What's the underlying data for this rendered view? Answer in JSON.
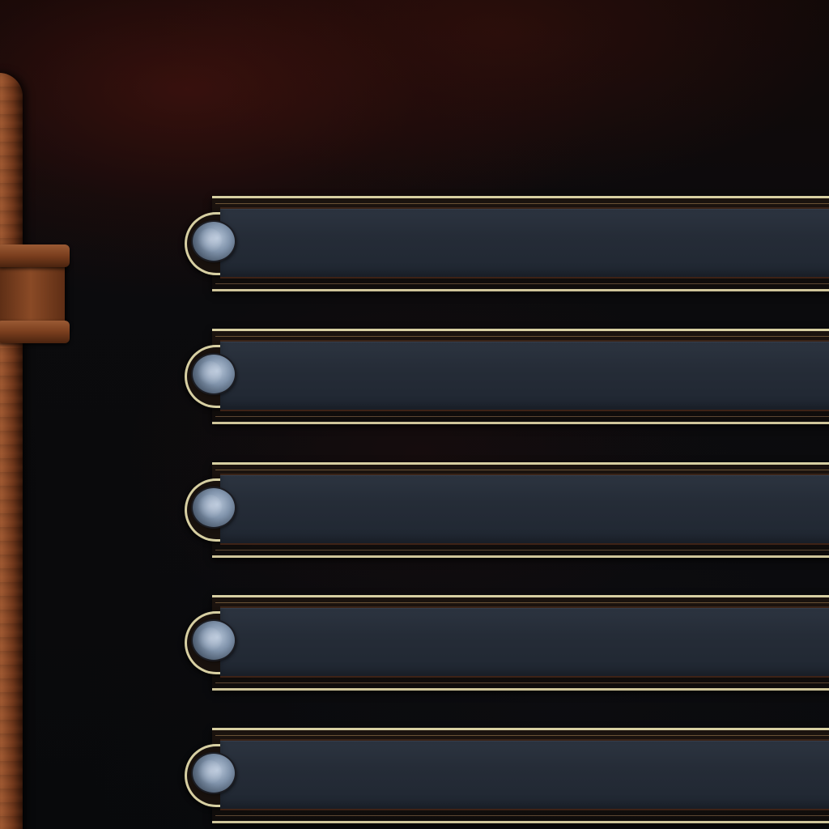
{
  "menu": {
    "slots": [
      {
        "label": ""
      },
      {
        "label": ""
      },
      {
        "label": ""
      },
      {
        "label": ""
      },
      {
        "label": ""
      }
    ]
  },
  "colors": {
    "frame_gold": "#d7cfa2",
    "panel_slate": "#252c37",
    "pearl": "#8093ab",
    "rust": "#8a4a26",
    "background": "#0a0a0c"
  }
}
